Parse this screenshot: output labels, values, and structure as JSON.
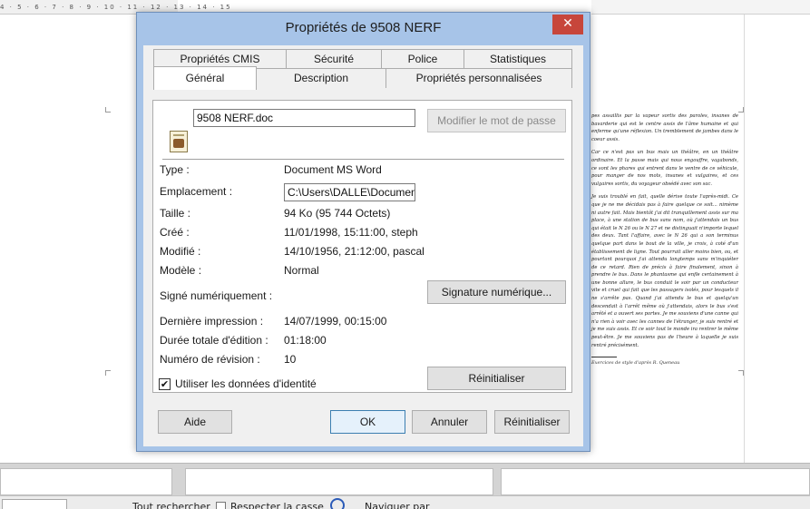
{
  "ruler": {
    "marks": "4 · 5 · 6 · 7 · 8 · 9 · 10 · 11 · 12 · 13 · 14 · 15"
  },
  "document": {
    "paragraphs": [
      "pes assaillis par la vapeur sortis des paroles, insanes de bavarderie qui est le centre assis de l'âme humaine et qui enferme qu'une réflexion. Un tremblement de jambes dans le coeur assis.",
      "Car ce n'est pas un bus mais un théâtre, en un théâtre ordinaire. Et la passe mais qui nous engouffre, vagabonds, ce sont les phares qui entrent dans le ventre de ce véhicule, pour manger de nos mots, insanes et vulgaires, et ces vulgaires sortis, du voyageur obsédé avec son sac.",
      "Je suis troublé en fait, quelle dérive toute l'après-midi. Ce que je ne me décidais pas à faire quelque ce soit... nimème ni autre fait. Mais bientôt j'ai dit tranquillement assis sur ma place, à une station de bus sans nom, où j'attendais un bus qui était le N 26 ou le N 27 et ne distinguait n'importe lequel des deux. Tant l'affaire, avec le N 26 qui a son terminus quelque part dans le bout de la ville, je crois, à coté d'un établissement de ligne. Tout pourrait aller moins bien, ou, et pourtant pourquoi j'ai attendu longtemps sans m'inquiéter de ce retard. Rien de précis à faire finalement, sinon à prendre le bus. Dans le phantasme qui enfle certainement à une bonne allure, le bus conduit le soir par un conducteur vite et cruel qui fait que les passagers isolés, pour lesquels il ne s'arrête pas. Quand j'ai attendu le bus et quelqu'un descendait à l'arrêt même où j'attendais, alors le bus s'est arrêté et a ouvert ses portes. Je me souviens d'une canne qui n'a rien à voir avec les cannes de l'étranger, je suis rentré et je me suis assis. Et ce soir tout le monde ira rentrer le même peut-être. Je me souviens pas de l'heure à laquelle je suis rentré précisément."
    ],
    "footnote": "Exercices de style d'après R. Queneau"
  },
  "find_bar": {
    "search_all": "Tout rechercher",
    "match_case": "Respecter la casse",
    "navigate": "Naviguer par"
  },
  "dialog": {
    "title": "Propriétés de 9508 NERF",
    "close_glyph": "✕",
    "tabs_row1": [
      "Propriétés CMIS",
      "Sécurité",
      "Police",
      "Statistiques"
    ],
    "tabs_row2": [
      "Général",
      "Description",
      "Propriétés personnalisées"
    ],
    "active_tab": "Général",
    "filename": "9508 NERF.doc",
    "change_password": "Modifier le mot de passe",
    "fields": {
      "type_label": "Type :",
      "type_value": "Document MS Word",
      "location_label": "Emplacement :",
      "location_value": "C:\\Users\\DALLE\\Documents",
      "size_label": "Taille :",
      "size_value": "94 Ko (95 744 Octets)",
      "created_label": "Créé :",
      "created_value": "11/01/1998, 15:11:00, steph",
      "modified_label": "Modifié :",
      "modified_value": "14/10/1956, 21:12:00, pascal",
      "template_label": "Modèle :",
      "template_value": "Normal",
      "signed_label": "Signé numériquement :",
      "digital_signature": "Signature numérique...",
      "last_printed_label": "Dernière impression :",
      "last_printed_value": "14/07/1999, 00:15:00",
      "editing_time_label": "Durée totale d'édition :",
      "editing_time_value": "01:18:00",
      "revision_label": "Numéro de révision :",
      "revision_value": "10"
    },
    "use_user_data": "Utiliser les données d'identité",
    "use_user_data_checked": true,
    "check_glyph": "✔",
    "reset_panel": "Réinitialiser",
    "buttons": {
      "help": "Aide",
      "ok": "OK",
      "cancel": "Annuler",
      "reset": "Réinitialiser"
    }
  },
  "colors": {
    "frame": "#a7c4e8",
    "close": "#c7463b",
    "default_button": "#3c7fb1"
  }
}
